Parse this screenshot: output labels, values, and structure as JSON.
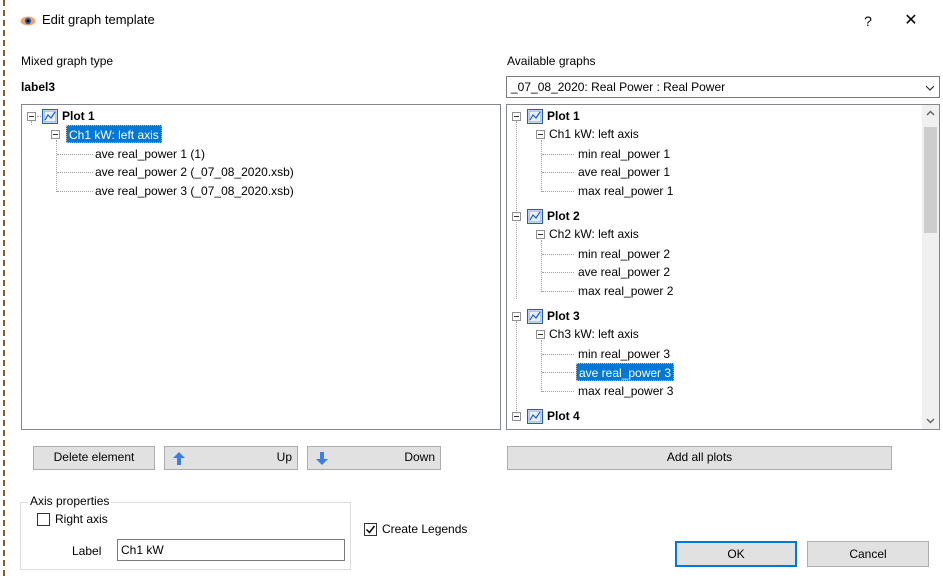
{
  "window": {
    "title": "Edit graph template",
    "help_label": "?",
    "close_label": "✕"
  },
  "left_panel": {
    "mixed_type_label": "Mixed graph type",
    "label3": "label3",
    "tree": {
      "plot_label": "Plot 1",
      "channel_label": "Ch1 kW: left axis",
      "items": [
        "ave real_power 1  (1)",
        "ave real_power 2  (_07_08_2020.xsb)",
        "ave real_power 3  (_07_08_2020.xsb)"
      ]
    },
    "buttons": {
      "delete": "Delete element",
      "up": "Up",
      "down": "Down"
    }
  },
  "right_panel": {
    "available_label": "Available graphs",
    "combo_value": "_07_08_2020: Real Power : Real Power",
    "tree": {
      "plots": [
        {
          "label": "Plot 1",
          "channel": "Ch1 kW: left axis",
          "items": [
            "min real_power 1",
            "ave real_power 1",
            "max real_power 1"
          ]
        },
        {
          "label": "Plot 2",
          "channel": "Ch2 kW: left axis",
          "items": [
            "min real_power 2",
            "ave real_power 2",
            "max real_power 2"
          ]
        },
        {
          "label": "Plot 3",
          "channel": "Ch3 kW: left axis",
          "items": [
            "min real_power 3",
            "ave real_power 3",
            "max real_power 3"
          ]
        },
        {
          "label": "Plot 4"
        }
      ],
      "selected": "ave real_power 3"
    },
    "add_all_label": "Add all plots"
  },
  "axis_properties": {
    "title": "Axis properties",
    "right_axis_label": "Right axis",
    "right_axis_checked": false,
    "label_caption": "Label",
    "label_value": "Ch1 kW"
  },
  "create_legends": {
    "label": "Create Legends",
    "checked": true
  },
  "footer": {
    "ok": "OK",
    "cancel": "Cancel"
  },
  "colors": {
    "selection": "#0078d7",
    "button_face": "#e1e1e1",
    "arrow_blue": "#3d7fe0"
  }
}
